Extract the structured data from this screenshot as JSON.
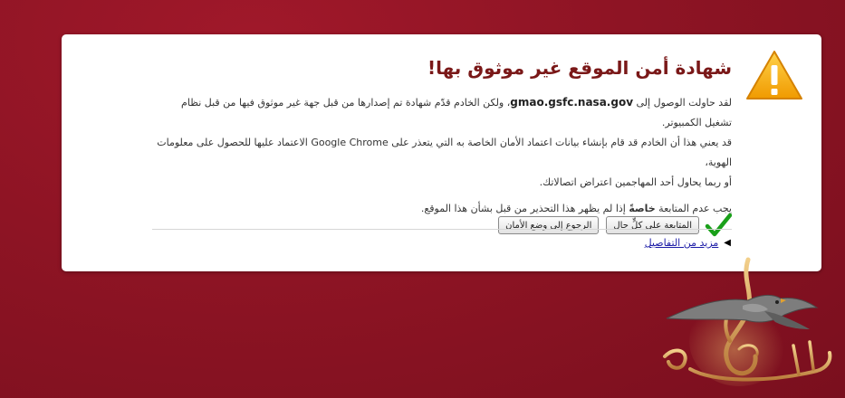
{
  "interstitial": {
    "title": "شهادة أمن الموقع غير موثوق بها!",
    "line1_before": "لقد حاولت الوصول إلى ",
    "hostname": "gmao.gsfc.nasa.gov",
    "line1_after": "، ولكن الخادم قدّم شهادة تم إصدارها من قبل جهة غير موثوق فيها من قبل نظام تشغيل الكمبيوتر.",
    "line2": "قد يعني هذا أن الخادم قد قام بإنشاء بيانات اعتماد الأمان الخاصة به التي يتعذر على Google Chrome الاعتماد عليها للحصول على معلومات الهوية،",
    "line3": "أو ربما يحاول أحد المهاجمين اعتراض اتصالاتك.",
    "warn_before": "يجب عدم المتابعة ",
    "warn_strong": "خاصةً",
    "warn_after": " إذا لم يظهر هذا التحذير من قبل بشأن هذا الموقع.",
    "proceed_label": "المتابعة على كلٍّ حال",
    "back_label": "الرجوع إلى وضع الأمان",
    "details_label": "مزيد من التفاصيل"
  },
  "colors": {
    "background": "#8e1424",
    "title": "#7a1818",
    "warning_icon": "#f0a000",
    "check_icon": "#1aa01a",
    "link": "#1a1aa6"
  },
  "icons": {
    "warning": "warning-triangle-icon",
    "check": "check-mark-icon",
    "details_arrow": "triangle-left-icon",
    "watermark": "falcon-logo"
  }
}
